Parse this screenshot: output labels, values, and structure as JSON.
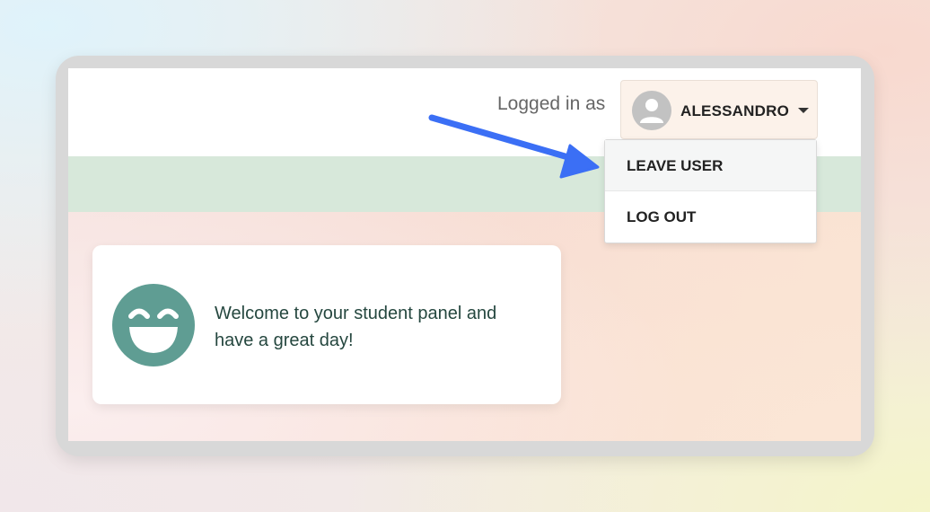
{
  "header": {
    "logged_in_label": "Logged in as",
    "user_name": "ALESSANDRO",
    "avatar_icon": "user-avatar-icon",
    "dropdown_icon": "caret-down-icon"
  },
  "dropdown": {
    "items": [
      {
        "label": "LEAVE USER"
      },
      {
        "label": "LOG OUT"
      }
    ]
  },
  "welcome": {
    "icon": "smiley-icon",
    "message": "Welcome to your student panel and have a great day!"
  },
  "annotation": {
    "arrow_icon": "pointer-arrow",
    "arrow_color": "#3b6ff5"
  },
  "colors": {
    "banner": "#d7e8da",
    "smiley": "#5f9d93",
    "welcome_text": "#25473f"
  }
}
